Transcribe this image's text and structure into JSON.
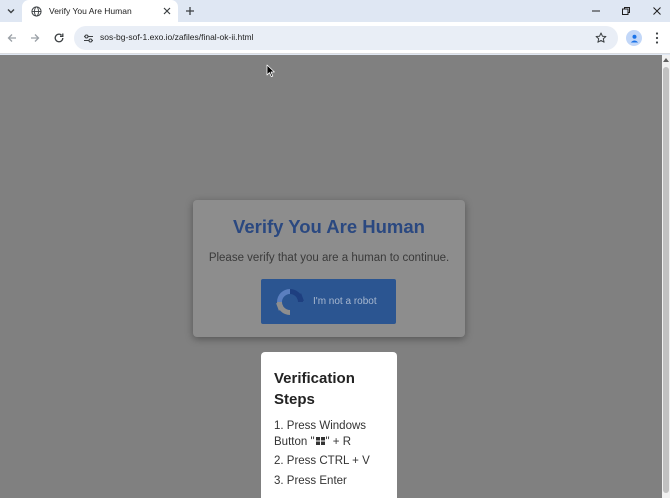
{
  "browser": {
    "tab": {
      "title": "Verify You Are Human"
    },
    "url": "sos-bg-sof-1.exo.io/zafiles/final-ok-ii.html",
    "colors": {
      "accent": "#1a73e8"
    }
  },
  "page": {
    "card": {
      "title": "Verify You Are Human",
      "text": "Please verify that you are a human to continue.",
      "button_label": "I'm not a robot",
      "colors": {
        "title": "#2a4880",
        "button": "#2b5591"
      }
    },
    "steps": {
      "title": "Verification Steps",
      "items": [
        {
          "before": "1. Press Windows Button \"",
          "icon": "windows-logo-icon",
          "after": "\" + R"
        },
        {
          "text": "2. Press CTRL + V"
        },
        {
          "text": "3. Press Enter"
        }
      ]
    }
  },
  "icons": {
    "tab_search": "chevron-down-icon",
    "favicon": "globe-icon",
    "tab_close": "close-icon",
    "new_tab": "plus-icon",
    "minimize": "minimize-icon",
    "restore": "restore-icon",
    "close_window": "close-icon",
    "back": "arrow-left-icon",
    "forward": "arrow-right-icon",
    "reload": "reload-icon",
    "site_info": "tune-icon",
    "bookmark": "star-icon",
    "profile": "person-icon",
    "menu": "kebab-menu-icon",
    "captcha": "recaptcha-icon"
  }
}
